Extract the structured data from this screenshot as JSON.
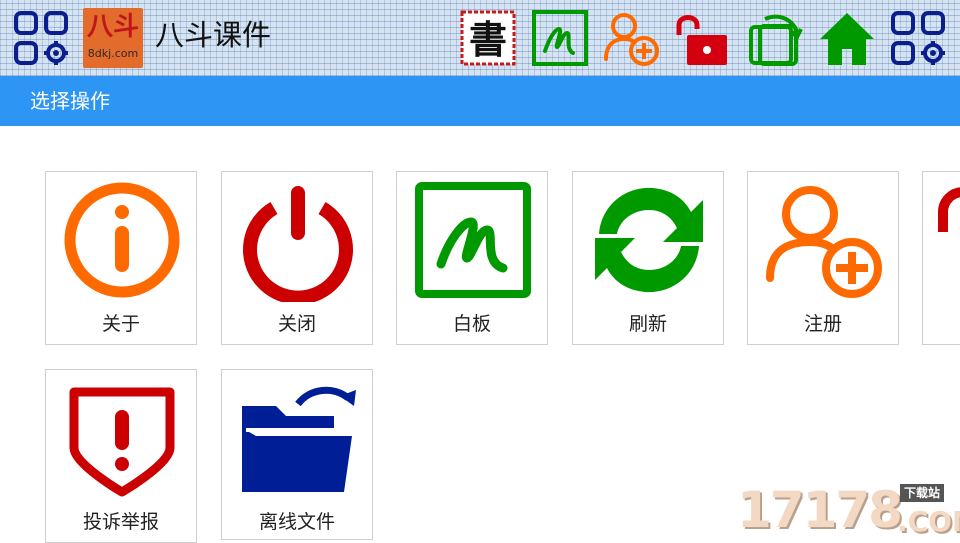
{
  "app": {
    "logo_main": "八斗",
    "logo_sub": "8dkj.com",
    "title": "八斗课件"
  },
  "toolbar": {
    "icons": [
      "menu-settings-icon",
      "calligraphy-icon",
      "whiteboard-icon",
      "add-user-icon",
      "unlock-icon",
      "rotate-screen-icon",
      "home-icon",
      "menu-settings-icon"
    ]
  },
  "subheader": {
    "title": "选择操作"
  },
  "tiles": [
    {
      "label": "关于",
      "icon": "info-icon",
      "color": "#ff6a00"
    },
    {
      "label": "关闭",
      "icon": "power-icon",
      "color": "#cc0000"
    },
    {
      "label": "白板",
      "icon": "whiteboard-icon",
      "color": "#009a00"
    },
    {
      "label": "刷新",
      "icon": "refresh-icon",
      "color": "#009a00"
    },
    {
      "label": "注册",
      "icon": "add-user-icon",
      "color": "#ff6a00"
    },
    {
      "label": "投诉举报",
      "icon": "report-shield-icon",
      "color": "#cc0000"
    },
    {
      "label": "离线文件",
      "icon": "offline-folder-icon",
      "color": "#001e96"
    }
  ],
  "watermark": {
    "number": "17178",
    "tag": "下载站",
    "domain": ".COM"
  },
  "colors": {
    "accent_blue": "#2d95f4",
    "orange": "#ff6a00",
    "red": "#cc0000",
    "green": "#009a00",
    "navy": "#001e96"
  }
}
